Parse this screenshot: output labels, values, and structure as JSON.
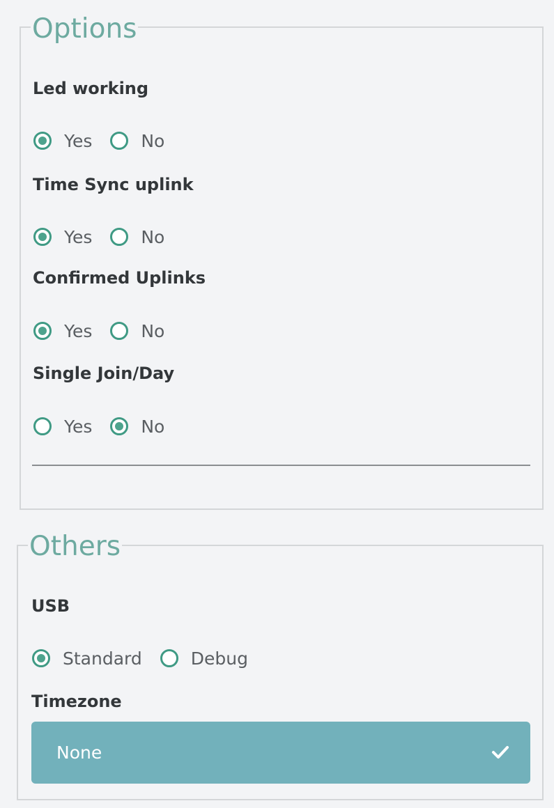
{
  "options": {
    "legend": "Options",
    "groups": [
      {
        "label": "Led working",
        "choices": [
          {
            "text": "Yes",
            "checked": true
          },
          {
            "text": "No",
            "checked": false
          }
        ]
      },
      {
        "label": "Time Sync uplink",
        "choices": [
          {
            "text": "Yes",
            "checked": true
          },
          {
            "text": "No",
            "checked": false
          }
        ]
      },
      {
        "label": "Confirmed Uplinks",
        "choices": [
          {
            "text": "Yes",
            "checked": true
          },
          {
            "text": "No",
            "checked": false
          }
        ]
      },
      {
        "label": "Single Join/Day",
        "choices": [
          {
            "text": "Yes",
            "checked": false
          },
          {
            "text": "No",
            "checked": true
          }
        ]
      }
    ]
  },
  "others": {
    "legend": "Others",
    "usb": {
      "label": "USB",
      "choices": [
        {
          "text": "Standard",
          "checked": true
        },
        {
          "text": "Debug",
          "checked": false
        }
      ]
    },
    "timezone": {
      "label": "Timezone",
      "selected": "None",
      "icon": "checkmark-icon"
    }
  },
  "colors": {
    "accent": "#3f9a84",
    "legend": "#6daaa0",
    "select_bg": "#72b1bb"
  }
}
